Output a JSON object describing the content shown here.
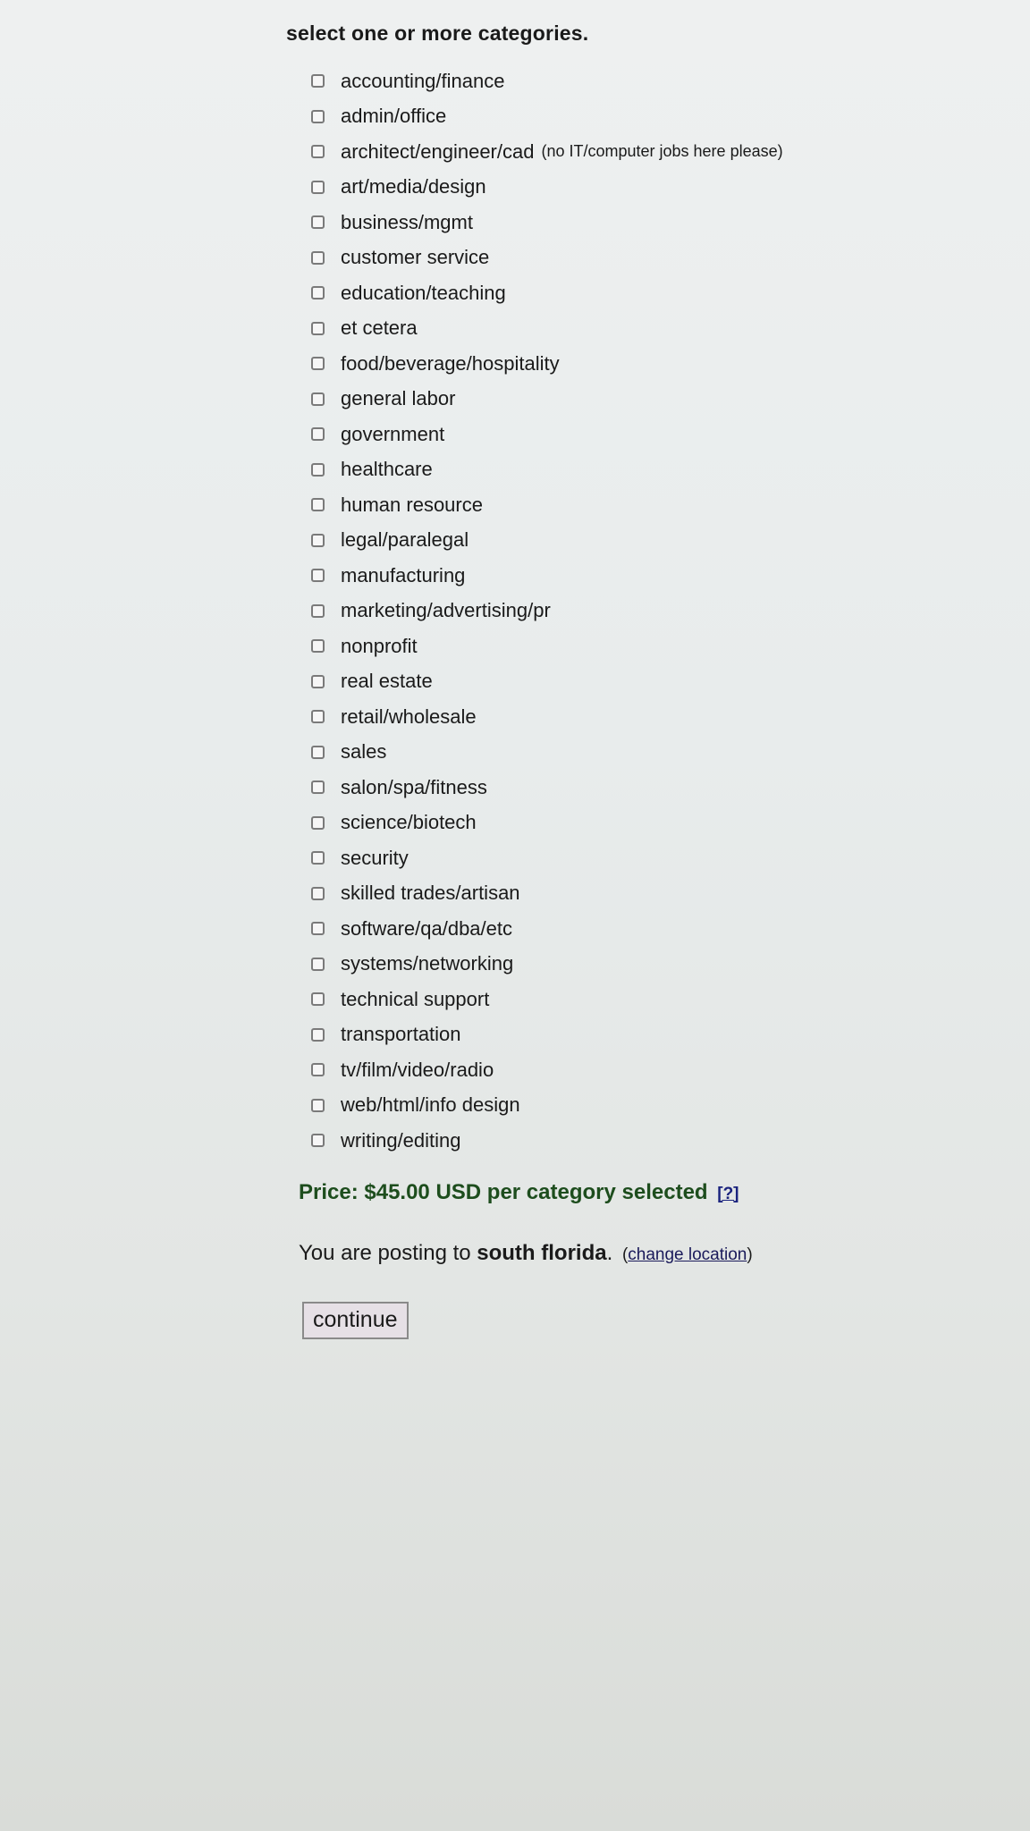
{
  "heading": "select one or more categories.",
  "categories": [
    {
      "label": "accounting/finance"
    },
    {
      "label": "admin/office"
    },
    {
      "label": "architect/engineer/cad",
      "note": "(no IT/computer jobs here please)"
    },
    {
      "label": "art/media/design"
    },
    {
      "label": "business/mgmt"
    },
    {
      "label": "customer service"
    },
    {
      "label": "education/teaching"
    },
    {
      "label": "et cetera"
    },
    {
      "label": "food/beverage/hospitality"
    },
    {
      "label": "general labor"
    },
    {
      "label": "government"
    },
    {
      "label": "healthcare"
    },
    {
      "label": "human resource"
    },
    {
      "label": "legal/paralegal"
    },
    {
      "label": "manufacturing"
    },
    {
      "label": "marketing/advertising/pr"
    },
    {
      "label": "nonprofit"
    },
    {
      "label": "real estate"
    },
    {
      "label": "retail/wholesale"
    },
    {
      "label": "sales"
    },
    {
      "label": "salon/spa/fitness"
    },
    {
      "label": "science/biotech"
    },
    {
      "label": "security"
    },
    {
      "label": "skilled trades/artisan"
    },
    {
      "label": "software/qa/dba/etc"
    },
    {
      "label": "systems/networking"
    },
    {
      "label": "technical support"
    },
    {
      "label": "transportation"
    },
    {
      "label": "tv/film/video/radio"
    },
    {
      "label": "web/html/info design"
    },
    {
      "label": "writing/editing"
    }
  ],
  "price": {
    "text": "Price: $45.00 USD per category selected",
    "help": "[?]"
  },
  "location": {
    "prefix": "You are posting to ",
    "place": "south florida",
    "suffix": ".",
    "change_open": "(",
    "change_link": "change location",
    "change_close": ")"
  },
  "continue_label": "continue"
}
